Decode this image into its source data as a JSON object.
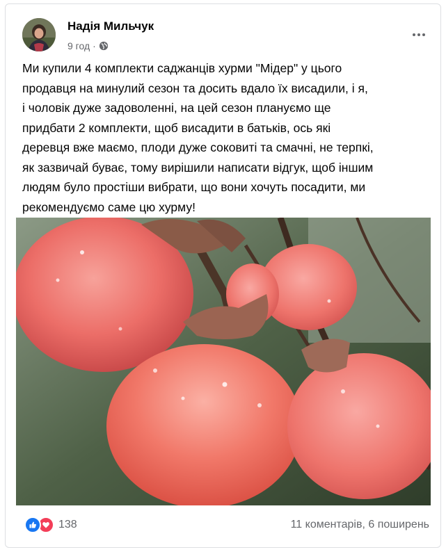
{
  "post": {
    "author": "Надія Мильчук",
    "time": "9 год",
    "separator": "·",
    "text": "Ми купили 4 комплекти саджанців хурми \"Мідер\" у цього\nпродавця на минулий сезон та досить вдало їх висадили, і я,\nі чоловік дуже задоволенні, на цей сезон плануємо ще\nпридбати 2 комплекти, щоб висадити в батьків, ось які\nдеревця вже маємо, плоди дуже соковиті та смачні, не терпкі,\nяк зазвичай буває, тому вирішили написати відгук, щоб іншим\nлюдям було простіши вибрати, що вони хочуть посадити, ми\nрекомендуємо саме цю хурму!"
  },
  "icons": {
    "privacy": "globe-icon",
    "menu": "more-horizontal-icon",
    "reaction_like": "like-icon",
    "reaction_love": "love-icon"
  },
  "footer": {
    "reactions_count": "138",
    "comments": "11 коментарів",
    "stats_separator": ", ",
    "shares": "6 поширень"
  },
  "colors": {
    "like": "#1877f2",
    "love": "#f33e58",
    "secondary_text": "#65676b"
  }
}
